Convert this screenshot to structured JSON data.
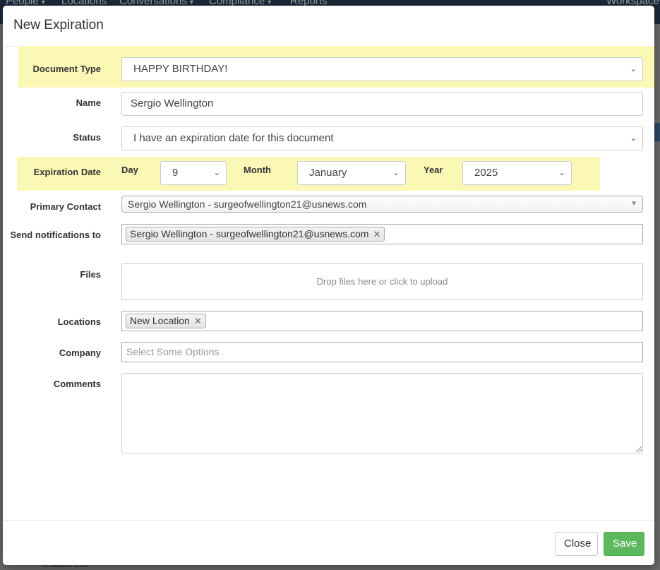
{
  "background": {
    "nav": [
      {
        "label": "People"
      },
      {
        "label": "Locations"
      },
      {
        "label": "Conversations"
      },
      {
        "label": "Compliance"
      },
      {
        "label": "Reports"
      },
      {
        "label": "Workspace:"
      }
    ],
    "bottom_text": "Teodoro Eric"
  },
  "modal": {
    "title": "New Expiration",
    "labels": {
      "document_type": "Document Type",
      "name": "Name",
      "status": "Status",
      "expiration_date": "Expiration Date",
      "day": "Day",
      "month": "Month",
      "year": "Year",
      "primary_contact": "Primary Contact",
      "send_notifications": "Send notifications to",
      "files": "Files",
      "locations": "Locations",
      "company": "Company",
      "comments": "Comments"
    },
    "values": {
      "document_type": "HAPPY BIRTHDAY!",
      "name": "Sergio Wellington",
      "status": "I have an expiration date for this document",
      "day": "9",
      "month": "January",
      "year": "2025",
      "primary_contact": "Sergio Wellington - surgeofwellington21@usnews.com",
      "notify_tag": "Sergio Wellington - surgeofwellington21@usnews.com",
      "location_tag": "New Location",
      "comments": ""
    },
    "placeholders": {
      "files": "Drop files here or click to upload",
      "company": "Select Some Options"
    },
    "buttons": {
      "close": "Close",
      "save": "Save"
    }
  },
  "colors": {
    "highlight": "#fbf8b5",
    "save_button": "#5cb85c",
    "navbar": "#1d2a3a"
  }
}
